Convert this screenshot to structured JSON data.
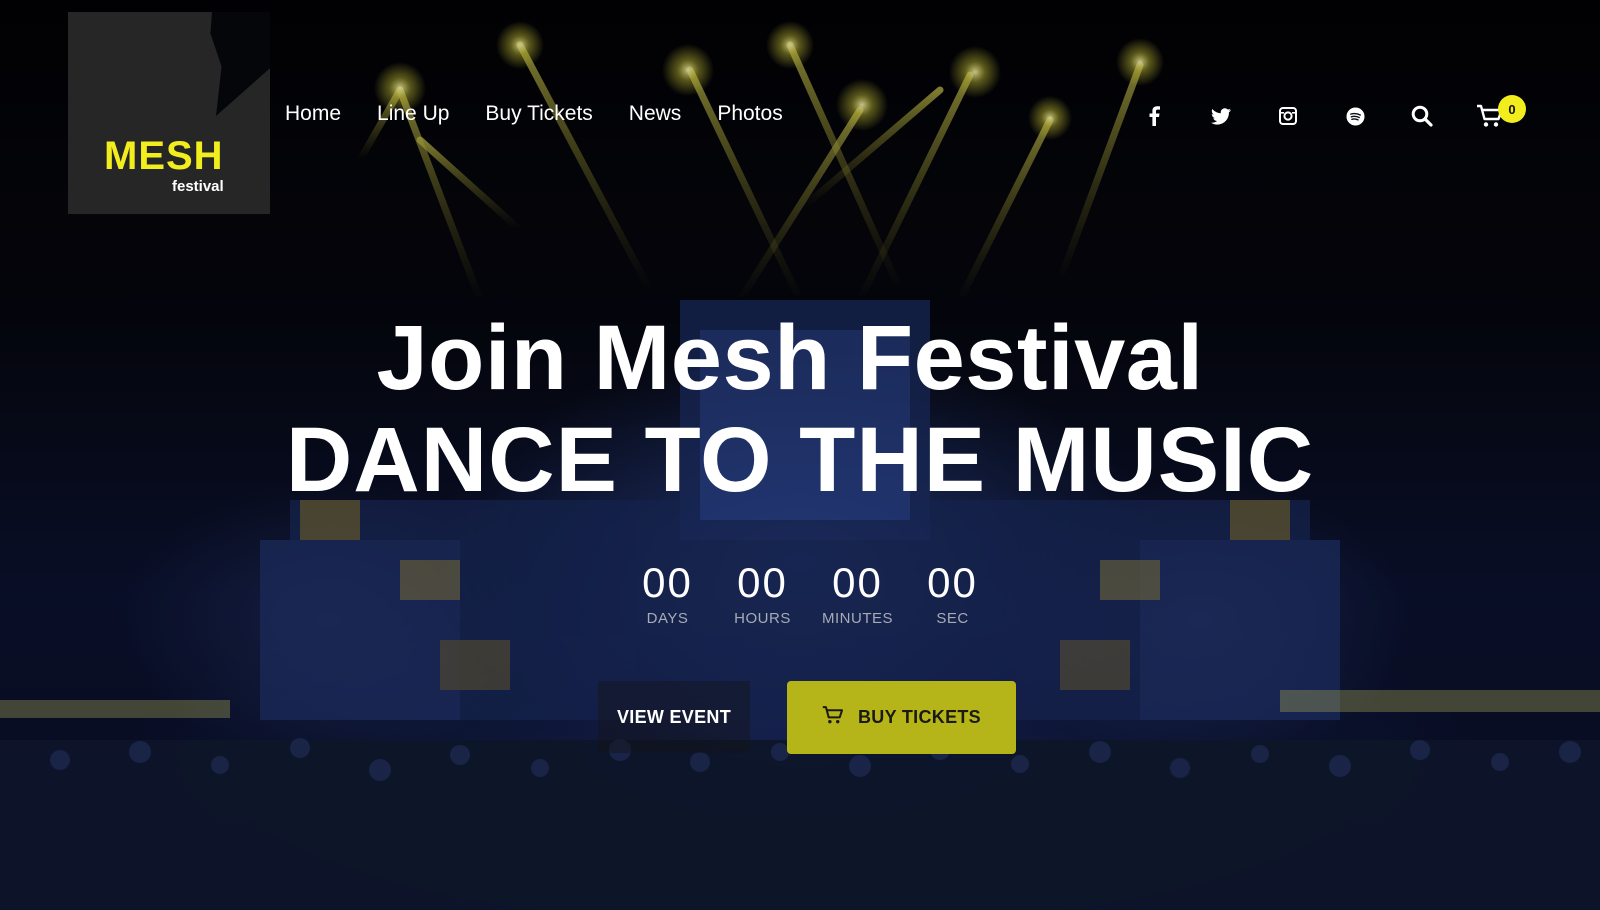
{
  "brand": {
    "logo_main": "MESH",
    "logo_sub": "festival"
  },
  "nav": {
    "items": [
      {
        "label": "Home"
      },
      {
        "label": "Line Up"
      },
      {
        "label": "Buy Tickets"
      },
      {
        "label": "News"
      },
      {
        "label": "Photos"
      }
    ]
  },
  "header_icons": [
    "facebook-icon",
    "twitter-icon",
    "instagram-icon",
    "spotify-icon",
    "search-icon",
    "cart-icon"
  ],
  "cart": {
    "count": "0"
  },
  "hero": {
    "title_line1": "Join Mesh Festival",
    "title_line2": "DANCE TO THE MUSIC"
  },
  "countdown": [
    {
      "value": "00",
      "label": "DAYS"
    },
    {
      "value": "00",
      "label": "HOURS"
    },
    {
      "value": "00",
      "label": "MINUTES"
    },
    {
      "value": "00",
      "label": "SEC"
    }
  ],
  "buttons": {
    "view_event": "VIEW EVENT",
    "buy_tickets": "BUY TICKETS"
  },
  "colors": {
    "accent": "#f2ee1d",
    "button_accent": "#b5b51a",
    "logo_bg": "#262626"
  }
}
